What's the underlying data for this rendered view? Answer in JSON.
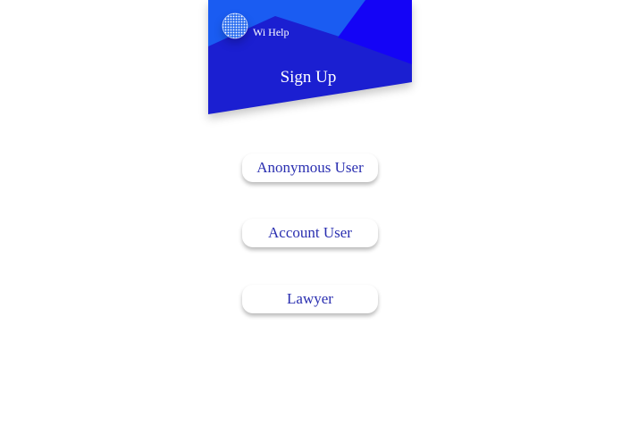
{
  "header": {
    "app_name": "Wi Help",
    "title": "Sign Up",
    "logo_icon": "globe-logo-icon",
    "colors": {
      "dark_blue": "#1b1fd1",
      "mid_blue": "#1a5cf2",
      "bright_blue": "#1404f6"
    }
  },
  "options": {
    "anonymous_label": "Anonymous User",
    "account_label": "Account User",
    "lawyer_label": "Lawyer"
  },
  "colors": {
    "button_text": "#2a2fb0",
    "background": "#ffffff"
  }
}
